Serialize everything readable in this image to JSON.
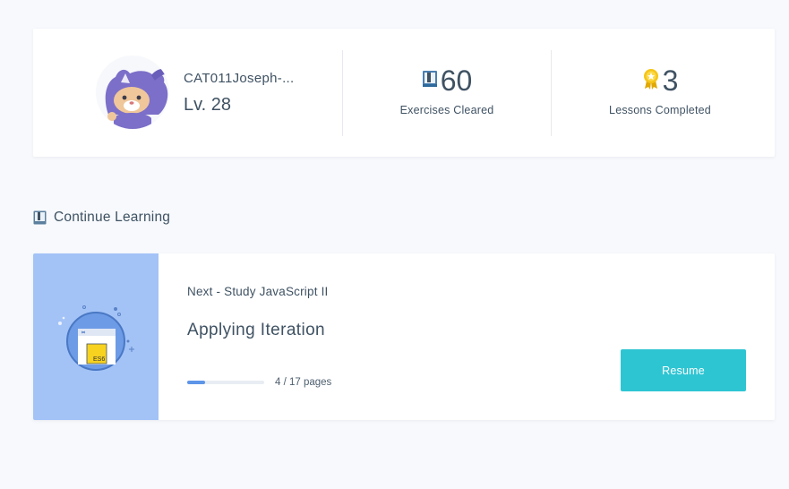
{
  "profile": {
    "username": "CAT011Joseph-...",
    "level": "Lv. 28",
    "avatar_icon": "ninja-cat-avatar-icon"
  },
  "stats": [
    {
      "value": "60",
      "label": "Exercises Cleared",
      "icon": "book-icon"
    },
    {
      "value": "3",
      "label": "Lessons Completed",
      "icon": "medal-icon"
    }
  ],
  "section": {
    "title": "Continue Learning",
    "icon": "book-icon"
  },
  "lesson": {
    "next_label": "Next - Study JavaScript II",
    "title": "Applying Iteration",
    "progress_fraction": 0.235,
    "pages_text": "4 / 17 pages",
    "resume_label": "Resume",
    "thumbnail_badge": "ES6"
  },
  "colors": {
    "background": "#f7f9fc",
    "card": "#ffffff",
    "text": "#3f5263",
    "thumbnail_bg": "#a3c3f7",
    "progress": "#5d95e8",
    "button": "#2ec5d3",
    "medal": "#f5c518"
  }
}
